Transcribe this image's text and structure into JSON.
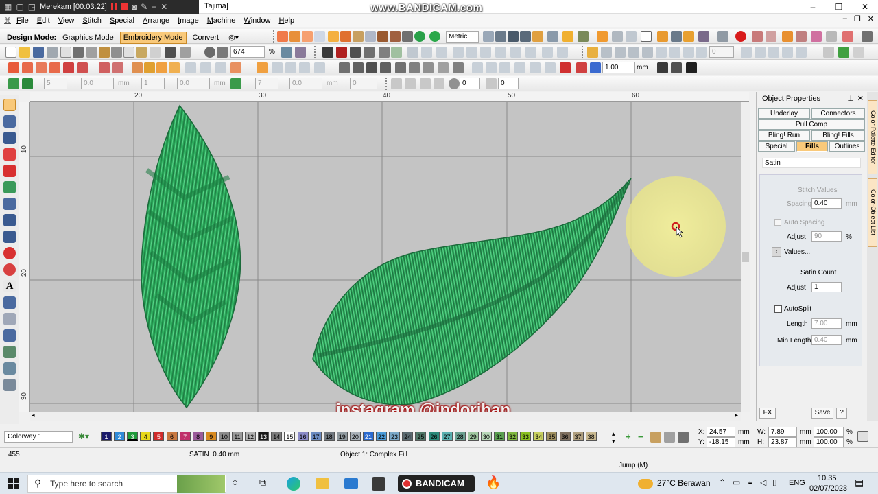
{
  "recorder": {
    "label": "Merekam [00:03:22]"
  },
  "window": {
    "title": "Tajima]",
    "watermark": "www.BANDICAM.com"
  },
  "menu": [
    "File",
    "Edit",
    "View",
    "Stitch",
    "Special",
    "Arrange",
    "Image",
    "Machine",
    "Window",
    "Help"
  ],
  "mode": {
    "label": "Design Mode:",
    "graphics": "Graphics Mode",
    "embroidery": "Embroidery Mode",
    "convert": "Convert"
  },
  "toolbar": {
    "units": "Metric",
    "zoom": "674",
    "zoom_unit": "%",
    "stitch_len": "1.00",
    "stitch_unit": "mm"
  },
  "toolbar3": {
    "v1": "5",
    "v2": "0.0",
    "v3": "mm",
    "v4": "1",
    "v5": "0.0",
    "v6": "mm",
    "v7": "7",
    "v8": "0.0",
    "v9": "mm",
    "v10": "0",
    "v11": "0",
    "v12": "0"
  },
  "ruler": {
    "top": [
      "20",
      "30",
      "40",
      "50",
      "60"
    ],
    "left": [
      "10",
      "20",
      "30"
    ]
  },
  "props": {
    "title": "Object Properties",
    "tabs": {
      "underlay": "Underlay",
      "connectors": "Connectors",
      "pullcomp": "Pull Comp",
      "blingrun": "Bling! Run",
      "blingfills": "Bling! Fills",
      "special": "Special",
      "fills": "Fills",
      "outlines": "Outlines"
    },
    "filltype": "Satin",
    "stitch_values": "Stitch Values",
    "spacing_label": "Spacing",
    "spacing": "0.40",
    "spacing_unit": "mm",
    "auto_spacing": "Auto Spacing",
    "adjust_label": "Adjust",
    "adjust": "90",
    "adjust_unit": "%",
    "values_btn": "Values...",
    "satin_count": "Satin Count",
    "adjust2": "1",
    "autosplit": "AutoSplit",
    "length_label": "Length",
    "length": "7.00",
    "length_unit": "mm",
    "minlength_label": "Min Length",
    "minlength": "0.40",
    "minlength_unit": "mm",
    "fx": "FX",
    "save": "Save",
    "help": "?"
  },
  "side_tabs": {
    "palette": "Color Palette Editor",
    "objlist": "Color-Object List"
  },
  "colorway": "Colorway 1",
  "swatches": [
    "1",
    "2",
    "3",
    "4",
    "5",
    "6",
    "7",
    "8",
    "9",
    "10",
    "11",
    "12",
    "13",
    "14",
    "15",
    "16",
    "17",
    "18",
    "19",
    "20",
    "21",
    "22",
    "23",
    "24",
    "25",
    "26",
    "27",
    "28",
    "29",
    "30",
    "31",
    "32",
    "33",
    "34",
    "35",
    "36",
    "37",
    "38"
  ],
  "swatch_colors": [
    "#1a1a6a",
    "#2f8ad8",
    "#1f9a3a",
    "#e8d81a",
    "#d02a2a",
    "#c87840",
    "#c0306a",
    "#9a5a9a",
    "#d88a20",
    "#8a8a8a",
    "#9a9a9a",
    "#b0b0b0",
    "#1a1a1a",
    "#7a7a7a",
    "#ffffff",
    "#8a8ac8",
    "#6a8ac0",
    "#707880",
    "#909aa0",
    "#a8b0b8",
    "#2a6ad0",
    "#4a9ad8",
    "#7aa8c8",
    "#5a6a70",
    "#507868",
    "#2a8a7a",
    "#5ab0b0",
    "#6aa090",
    "#a0c8a0",
    "#b8d8b8",
    "#5aa050",
    "#80b840",
    "#8ac020",
    "#c8d060",
    "#a09060",
    "#807060",
    "#b0a080",
    "#c8b890"
  ],
  "coords": {
    "x_label": "X:",
    "x": "24.57",
    "y_label": "Y:",
    "y": "-18.15",
    "w_label": "W:",
    "w": "7.89",
    "h_label": "H:",
    "h": "23.87",
    "unit": "mm",
    "pw": "100.00",
    "ph": "100.00",
    "pct": "%"
  },
  "status": {
    "count": "455",
    "stitch": "SATIN  0.40 mm",
    "object": "Object 1: Complex Fill",
    "jump": "Jump (M)"
  },
  "overlay": {
    "instagram": "instagram @indorihan"
  },
  "taskbar": {
    "search": "Type here to search",
    "bandicam": "BANDICAM",
    "weather": "27°C Berawan",
    "lang": "ENG",
    "time": "10.35",
    "date": "02/07/2023"
  }
}
